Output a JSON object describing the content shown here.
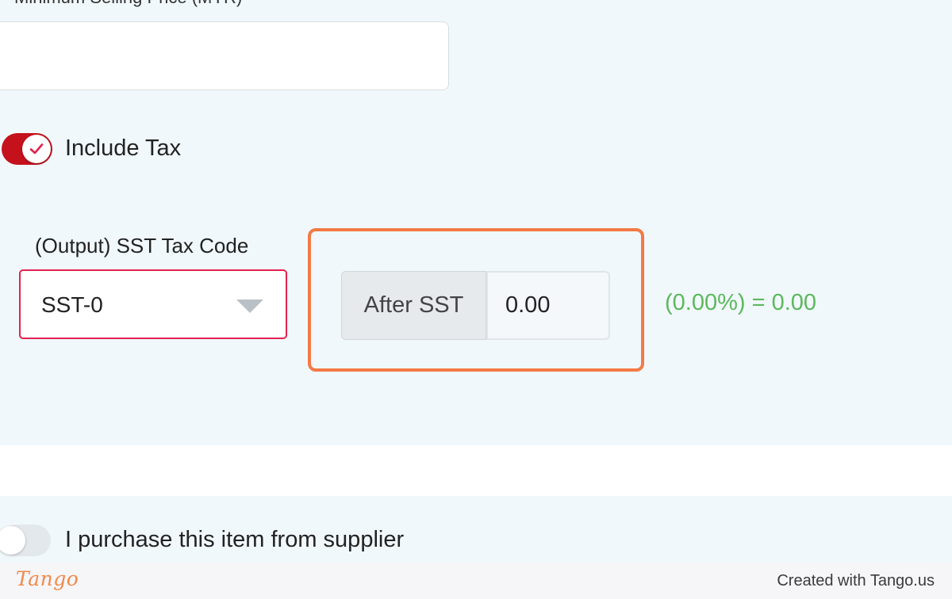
{
  "form": {
    "cut_off_label": "Minimum Selling Price (MYR)",
    "price_value": "",
    "include_tax": {
      "label": "Include Tax",
      "checked": true
    },
    "tax_code": {
      "label": "(Output) SST Tax Code",
      "selected": "SST-0"
    },
    "after_sst": {
      "addon_label": "After SST",
      "value": "0.00"
    },
    "result_text": "(0.00%) = 0.00",
    "supplier": {
      "label": "I purchase this item from supplier",
      "checked": false
    }
  },
  "footer": {
    "logo_text": "Tango",
    "credit": "Created with Tango.us"
  },
  "colors": {
    "toggle_on": "#c5111c",
    "select_border": "#e3214f",
    "highlight": "#f47a45",
    "result_text": "#5cb85c",
    "panel_bg": "#f1f8fc"
  },
  "icons": {
    "toggle_check": "check-icon",
    "select_caret": "chevron-down-icon"
  }
}
